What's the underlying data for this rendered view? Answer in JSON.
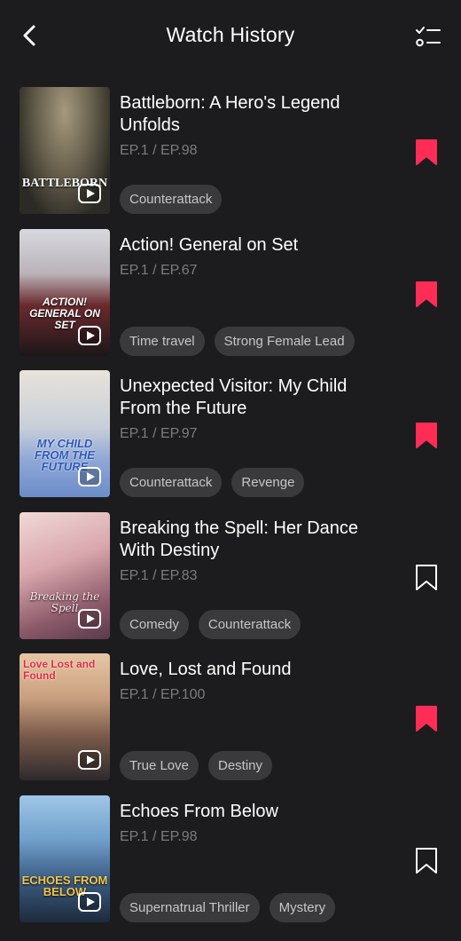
{
  "header": {
    "title": "Watch History",
    "back_icon": "chevron-left-icon",
    "edit_icon": "checklist-icon"
  },
  "colors": {
    "background": "#1c1c1e",
    "tag_background": "#3a3a3c",
    "accent_bookmark": "#ff2d55",
    "secondary_text": "#7c7c80"
  },
  "items": [
    {
      "title": "Battleborn: A Hero's Legend Unfolds",
      "episode": "EP.1 / EP.98",
      "tags": [
        "Counterattack"
      ],
      "bookmarked": true,
      "poster_text": "BATTLEBORN"
    },
    {
      "title": "Action! General on Set",
      "episode": "EP.1 / EP.67",
      "tags": [
        "Time travel",
        "Strong Female Lead"
      ],
      "bookmarked": true,
      "poster_text": "ACTION! GENERAL ON SET"
    },
    {
      "title": "Unexpected Visitor: My Child From the Future",
      "episode": "EP.1 / EP.97",
      "tags": [
        "Counterattack",
        "Revenge"
      ],
      "bookmarked": true,
      "poster_text": "MY CHILD FROM THE FUTURE"
    },
    {
      "title": "Breaking the Spell: Her Dance With Destiny",
      "episode": "EP.1 / EP.83",
      "tags": [
        "Comedy",
        "Counterattack"
      ],
      "bookmarked": false,
      "poster_text": "Breaking the Spell"
    },
    {
      "title": "Love, Lost and Found",
      "episode": "EP.1 / EP.100",
      "tags": [
        "True Love",
        "Destiny"
      ],
      "bookmarked": true,
      "poster_text": "Love Lost and Found"
    },
    {
      "title": "Echoes From Below",
      "episode": "EP.1 / EP.98",
      "tags": [
        "Supernatrual Thriller",
        "Mystery"
      ],
      "bookmarked": false,
      "poster_text": "ECHOES FROM BELOW"
    }
  ]
}
